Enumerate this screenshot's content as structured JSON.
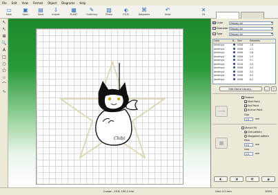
{
  "menu": [
    "File",
    "Edit",
    "View",
    "Format",
    "Object",
    "Diagrams",
    "Help"
  ],
  "toolbar": [
    {
      "label": "New",
      "icon": "new-doc-icon",
      "glyph": "▭"
    },
    {
      "label": "Open",
      "icon": "open-folder-icon",
      "glyph": "▣"
    },
    {
      "label": "Save",
      "icon": "save-icon",
      "glyph": "▤"
    },
    {
      "label": "Import",
      "icon": "import-icon",
      "glyph": "⇩"
    },
    {
      "label": "PLANT",
      "icon": "plant-icon",
      "glyph": "▦"
    },
    {
      "label": "Outlining",
      "icon": "outlining-icon",
      "glyph": "✎"
    },
    {
      "label": "Photo",
      "icon": "photo-icon",
      "glyph": "▧"
    },
    {
      "label": "P.S.D.",
      "icon": "psd-icon",
      "glyph": "⬖"
    },
    {
      "label": "Diagrams",
      "icon": "diagrams-icon",
      "glyph": "⌘"
    },
    {
      "label": "Undo",
      "icon": "undo-icon",
      "glyph": "↶"
    },
    {
      "label": "Fit",
      "icon": "fit-icon",
      "glyph": "✕"
    }
  ],
  "tabs": [
    "Rhinestone",
    ""
  ],
  "left_tools": [
    "↖",
    "↖",
    "⊞",
    "🔍",
    "A",
    "□",
    "○",
    "⬠",
    "☆",
    "⌒",
    "∿"
  ],
  "panel": {
    "color_label": "Color",
    "color_value": "Display all",
    "diameter_label": "Diameter",
    "diameter_value": "Display all",
    "type_label": "Type",
    "type_value": "Display all",
    "list_headers": [
      "Color",
      "D...",
      "Size",
      "Elements"
    ],
    "list_rows": [
      [
        "Amethyst",
        "SS08",
        "1.6"
      ],
      [
        "Amethyst",
        "SS06",
        "2.1"
      ],
      [
        "Amethyst",
        "SS06",
        "2.6"
      ],
      [
        "Amethyst",
        "SS06",
        "2.9"
      ],
      [
        "Amethyst",
        "SS10",
        "3.1"
      ],
      [
        "Amethyst",
        "SS16",
        "4.0"
      ],
      [
        "Amethyst",
        "SS08",
        "4.5"
      ],
      [
        "Amethyst",
        "SS08",
        "5.0"
      ],
      [
        "Amethyst",
        "SS08",
        "6.0"
      ],
      [
        "Amethyst",
        "SS08",
        "6.0"
      ]
    ],
    "edit_button": "Edit Stone Library...",
    "stones_label": "...",
    "feature_label": "Feature",
    "start_point": "Start Point",
    "end_point": "End Point",
    "anchor_point": "Anchor Point",
    "gap_label": "Gap",
    "gap_value": "1.0",
    "unit": "mm",
    "stencil_label": "Stencil Fill",
    "grid_pattern": "Grid pattern",
    "staggered_pattern": "Staggered pattern",
    "pitch_label": "Pitch",
    "pitch_value": "3.0",
    "gap2_label": "Gap",
    "gap2_value": "1.0"
  },
  "status": {
    "cursor": "Cursor: -19.6, 190.2 mm",
    "grid": "Grid: 5.0 mm",
    "zoom": "100%"
  },
  "canvas": {
    "signature": "Chibi"
  },
  "colors": {
    "canvas_top": "#1f8a2e",
    "paper": "#ffffff",
    "selection": "#2b3d8f"
  }
}
